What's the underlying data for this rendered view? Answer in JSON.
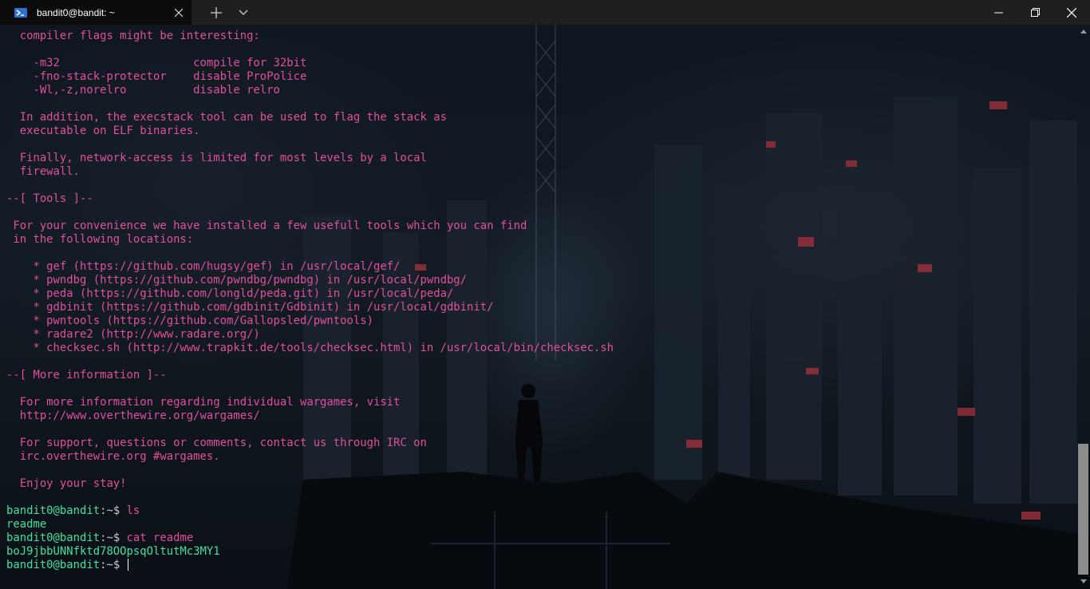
{
  "window": {
    "tab_title": "bandit0@bandit: ~",
    "tab_icon": "powershell-icon",
    "buttons": [
      "close-tab-icon",
      "new-tab-icon",
      "dropdown-icon",
      "minimize-icon",
      "restore-icon",
      "close-icon"
    ]
  },
  "colors": {
    "text": "#e0509a",
    "prompt": "#3ee0a0",
    "titlebar": "#1f1f1f",
    "active_tab": "#0c0c0c"
  },
  "terminal": {
    "lines": [
      "  compiler flags might be interesting:",
      "",
      "    -m32                    compile for 32bit",
      "    -fno-stack-protector    disable ProPolice",
      "    -Wl,-z,norelro          disable relro",
      "",
      "  In addition, the execstack tool can be used to flag the stack as",
      "  executable on ELF binaries.",
      "",
      "  Finally, network-access is limited for most levels by a local",
      "  firewall.",
      "",
      "--[ Tools ]--",
      "",
      " For your convenience we have installed a few usefull tools which you can find",
      " in the following locations:",
      "",
      "    * gef (https://github.com/hugsy/gef) in /usr/local/gef/",
      "    * pwndbg (https://github.com/pwndbg/pwndbg) in /usr/local/pwndbg/",
      "    * peda (https://github.com/longld/peda.git) in /usr/local/peda/",
      "    * gdbinit (https://github.com/gdbinit/Gdbinit) in /usr/local/gdbinit/",
      "    * pwntools (https://github.com/Gallopsled/pwntools)",
      "    * radare2 (http://www.radare.org/)",
      "    * checksec.sh (http://www.trapkit.de/tools/checksec.html) in /usr/local/bin/checksec.sh",
      "",
      "--[ More information ]--",
      "",
      "  For more information regarding individual wargames, visit",
      "  http://www.overthewire.org/wargames/",
      "",
      "  For support, questions or comments, contact us through IRC on",
      "  irc.overthewire.org #wargames.",
      "",
      "  Enjoy your stay!",
      ""
    ],
    "session": [
      {
        "user": "bandit0@bandit",
        "sep": ":~$ ",
        "cmd": "ls"
      },
      {
        "output": "readme"
      },
      {
        "user": "bandit0@bandit",
        "sep": ":~$ ",
        "cmd": "cat readme"
      },
      {
        "output": "boJ9jbbUNNfktd78OOpsqOltutMc3MY1"
      },
      {
        "user": "bandit0@bandit",
        "sep": ":~$ ",
        "cmd": "",
        "cursor": true
      }
    ]
  }
}
